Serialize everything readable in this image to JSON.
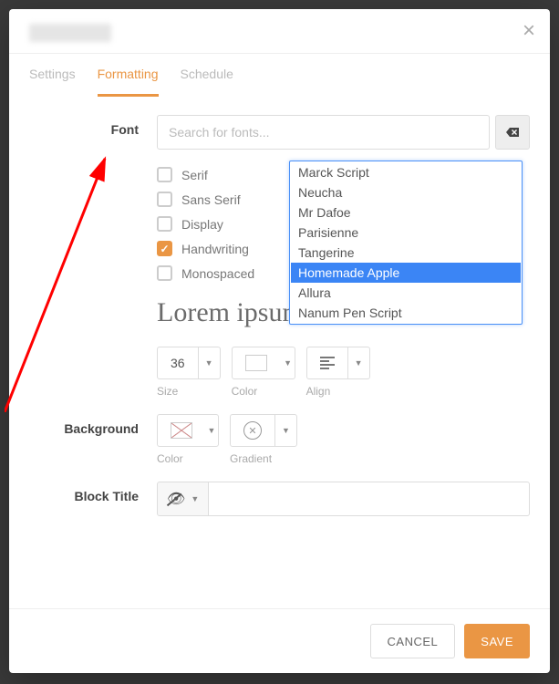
{
  "tabs": {
    "settings": "Settings",
    "formatting": "Formatting",
    "schedule": "Schedule"
  },
  "font": {
    "label": "Font",
    "placeholder": "Search for fonts...",
    "filters": {
      "serif": "Serif",
      "sans": "Sans Serif",
      "display": "Display",
      "handwriting": "Handwriting",
      "mono": "Monospaced"
    },
    "options": {
      "marck": "Marck Script",
      "neucha": "Neucha",
      "dafoe": "Mr Dafoe",
      "parisienne": "Parisienne",
      "tangerine": "Tangerine",
      "homemade": "Homemade Apple",
      "allura": "Allura",
      "nanum": "Nanum Pen Script"
    },
    "preview": "Lorem ipsum dolor sit amet"
  },
  "controls": {
    "size_value": "36",
    "size_label": "Size",
    "color_label": "Color",
    "align_label": "Align"
  },
  "background": {
    "label": "Background",
    "color_label": "Color",
    "gradient_label": "Gradient"
  },
  "block_title": {
    "label": "Block Title",
    "value": ""
  },
  "buttons": {
    "cancel": "CANCEL",
    "save": "SAVE"
  }
}
